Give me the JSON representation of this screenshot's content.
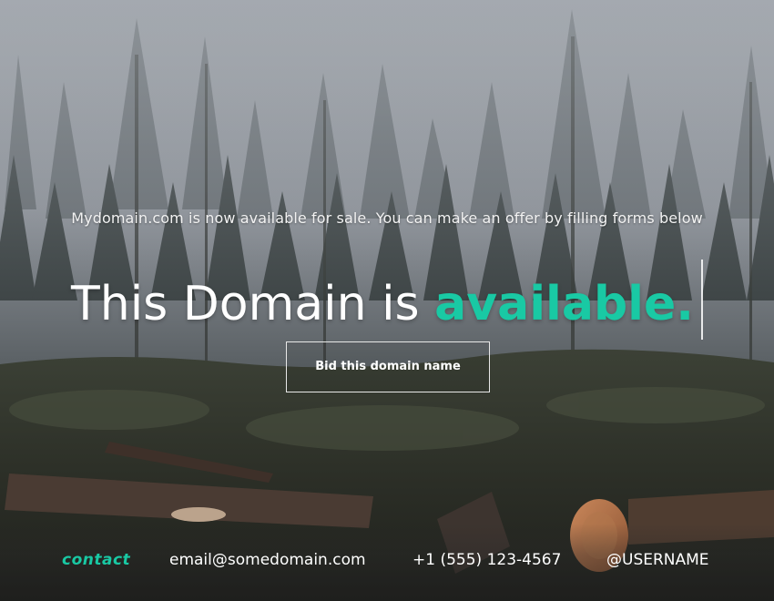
{
  "colors": {
    "accent": "#19c9a4",
    "text": "#ffffff"
  },
  "hero": {
    "tagline": "Mydomain.com is now available for sale. You can make an offer by filling forms below",
    "headline_prefix": "This Domain is ",
    "headline_accent": "available."
  },
  "cta": {
    "bid_label": "Bid this domain name"
  },
  "footer": {
    "contact_label": "contact",
    "email": "email@somedomain.com",
    "phone": "+1 (555) 123-4567",
    "username": "@USERNAME"
  },
  "background": {
    "icon": "misty-forest-image"
  }
}
